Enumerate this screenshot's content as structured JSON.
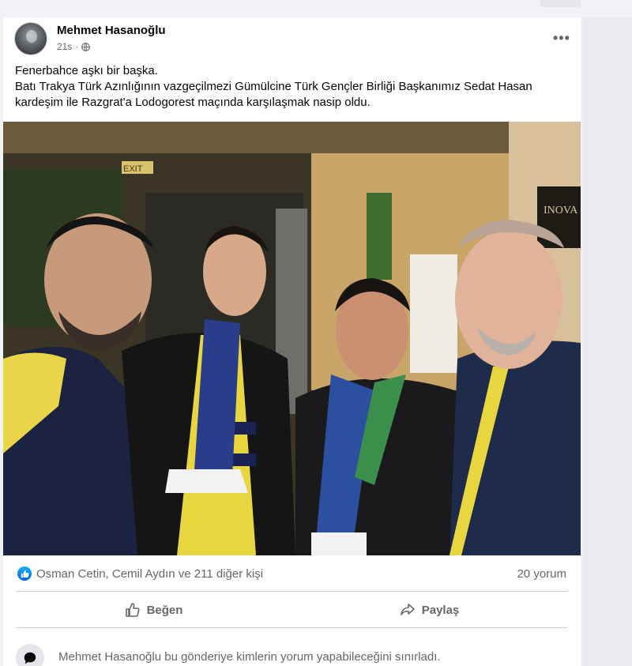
{
  "post": {
    "author": "Mehmet Hasanoğlu",
    "time": "21s",
    "more_label": "•••",
    "caption_lines": [
      "Fenerbahce aşkı bir başka.",
      "Batı Trakya Türk Azınlığının vazgeçilmezi Gümülcine Türk Gençler Birliği Başkanımız Sedat Hasan",
      "kardeşim ile Razgrat'a Lodogorest maçında karşılaşmak nasip oldu."
    ],
    "photo_sign_text": "INOVA",
    "photo_exit_text": "EXIT"
  },
  "reactions": {
    "names": "Osman Cetin, Cemil Aydın ve 211 diğer kişi",
    "comments": "20 yorum"
  },
  "actions": {
    "like": "Beğen",
    "share": "Paylaş"
  },
  "notice": {
    "text": "Mehmet Hasanoğlu bu gönderiye kimlerin yorum yapabileceğini sınırladı."
  },
  "colors": {
    "facebook_blue": "#1877f2",
    "secondary_text": "#65676b",
    "divider": "#ced0d4"
  }
}
